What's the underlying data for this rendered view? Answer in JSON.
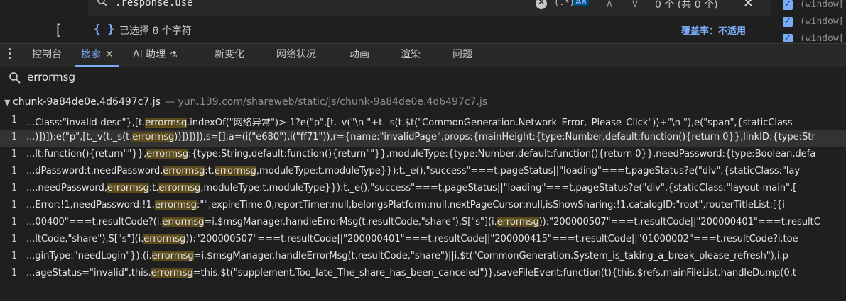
{
  "find_bar": {
    "query": ".response.use",
    "regex_label": "(.*)",
    "case_label": "Aa",
    "count": "0 个 (共 0 个)",
    "bracket": "["
  },
  "selection_bar": {
    "icon_text": "{ }",
    "text": "已选择 8 个字符",
    "coverage": "覆盖率：不适用"
  },
  "right_pane": {
    "items": [
      {
        "text": "(window[",
        "checked": true
      },
      {
        "text": "(window[",
        "checked": true
      },
      {
        "text": "(window[",
        "checked": true
      }
    ]
  },
  "tabs": [
    {
      "label": "控制台"
    },
    {
      "label": "搜索",
      "active": true,
      "closable": true
    },
    {
      "label": "AI 助理",
      "experimental": true
    },
    {
      "label": "新变化"
    },
    {
      "label": "网络状况"
    },
    {
      "label": "动画"
    },
    {
      "label": "渲染"
    },
    {
      "label": "问题"
    }
  ],
  "search": {
    "query": "errormsg"
  },
  "results": {
    "file": "chunk-9a84de0e.4d6497c7.js",
    "path": "— yun.139.com/shareweb/static/js/chunk-9a84de0e.4d6497c7.js",
    "highlight": "errormsg",
    "rows": [
      {
        "line": "1",
        "text": "...Class:\"invalid-desc\"},[t.errormsg.indexOf(\"网络异常\")>-1?e(\"p\",[t._v(\"\\n \"+t._s(t.$t(\"CommonGeneration.Network_Error,_Please_Click\"))+\"\\n \"),e(\"span\",{staticClass"
      },
      {
        "line": "1",
        "text": "...)])]):e(\"p\",[t._v(t._s(t.errormsg))])])]),s=[],a=(i(\"e680\"),i(\"ff71\")),r={name:\"invalidPage\",props:{mainHeight:{type:Number,default:function(){return 0}},linkID:{type:Str",
        "selected": true
      },
      {
        "line": "1",
        "text": "...lt:function(){return\"\"}},errormsg:{type:String,default:function(){return\"\"}},moduleType:{type:Number,default:function(){return 0}},needPassword:{type:Boolean,defa"
      },
      {
        "line": "1",
        "text": "...dPassword:t.needPassword,errormsg:t.errormsg,moduleType:t.moduleType}}):t._e(),\"success\"===t.pageStatus||\"loading\"===t.pageStatus?e(\"div\",{staticClass:\"lay"
      },
      {
        "line": "1",
        "text": "....needPassword,errormsg:t.errormsg,moduleType:t.moduleType}}):t._e(),\"success\"===t.pageStatus||\"loading\"===t.pageStatus?e(\"div\",{staticClass:\"layout-main\",["
      },
      {
        "line": "1",
        "text": "...Error:!1,needPassword:!1,errormsg:\"\",expireTime:0,reportTimer:null,belongsPlatform:null,nextPageCursor:null,isShowSharing:!1,catalogID:\"root\",routerTitleList:[{i"
      },
      {
        "line": "1",
        "text": "...00400\"===t.resultCode?(i.errormsg=i.$msgManager.handleErrorMsg(t.resultCode,\"share\"),S[\"s\"](i.errormsg)):\"200000507\"===t.resultCode||\"200000401\"===t.resultC"
      },
      {
        "line": "1",
        "text": "...ltCode,\"share\"),S[\"s\"](i.errormsg)):\"200000507\"===t.resultCode||\"200000401\"===t.resultCode||\"200000415\"===t.resultCode||\"01000002\"===t.resultCode?i.toe"
      },
      {
        "line": "1",
        "text": "...ginType:\"needLogin\"}):(i.errormsg=i.$msgManager.handleErrorMsg(t.resultCode,\"share\")||i.$t(\"CommonGeneration.System_is_taking_a_break_please_refresh\"),i.p"
      },
      {
        "line": "1",
        "text": "...ageStatus=\"invalid\",this.errormsg=this.$t(\"supplement.Too_late_The_share_has_been_canceled\")},saveFileEvent:function(t){this.$refs.mainFileList.handleDump(0,t"
      }
    ]
  }
}
